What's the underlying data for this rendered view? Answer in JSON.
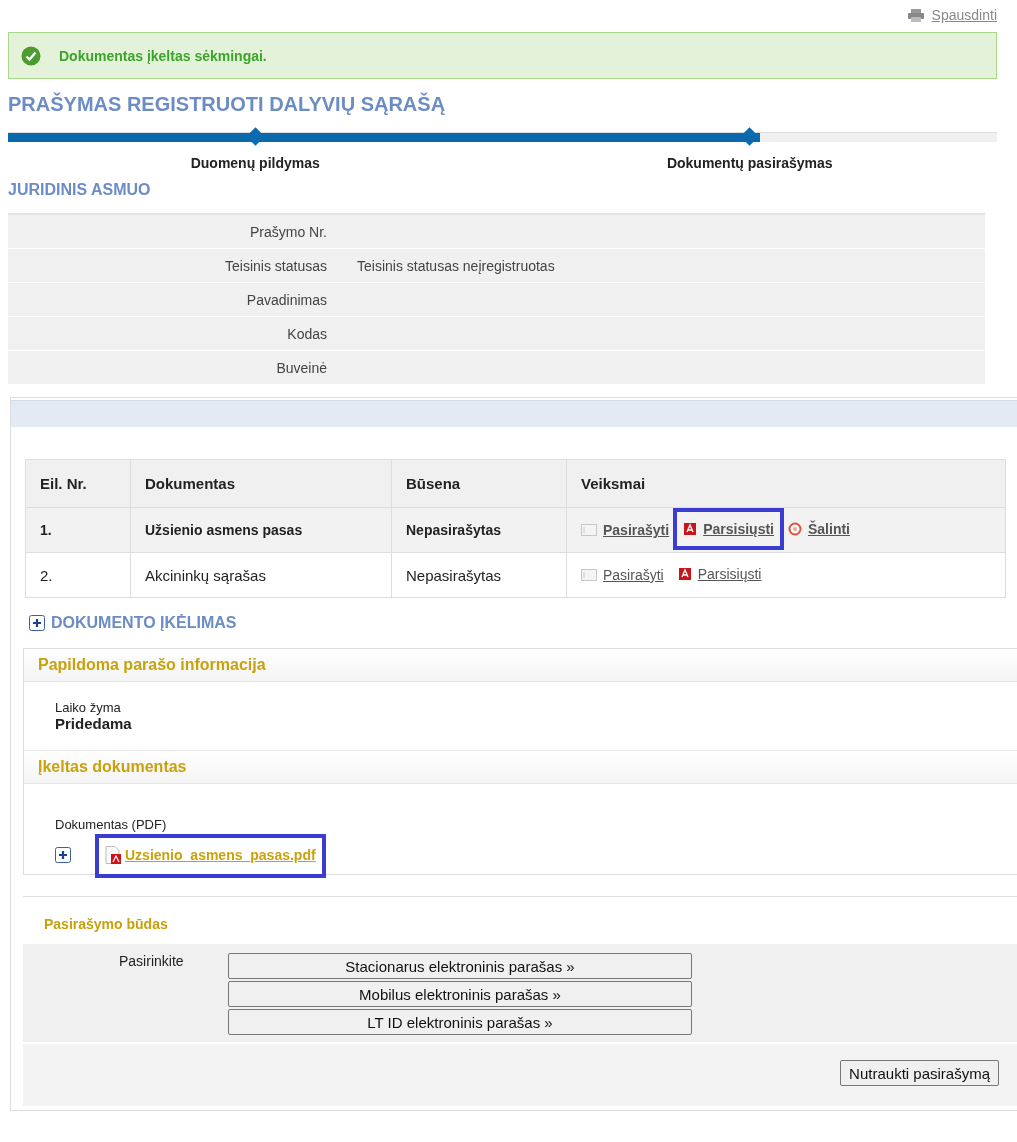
{
  "print_link": {
    "label": "Spausdinti"
  },
  "message": {
    "kind": "success",
    "text": "Dokumentas įkeltas sėkmingai."
  },
  "title": "PRAŠYMAS REGISTRUOTI DALYVIŲ SĄRAŠĄ",
  "progress": {
    "level": 0.76,
    "steps": [
      {
        "label": "Duomenų pildymas",
        "reached": true
      },
      {
        "label": "Dokumentų pasirašymas",
        "reached": true
      }
    ]
  },
  "section_title": "JURIDINIS ASMUO",
  "details": [
    {
      "label": "Prašymo Nr."
    },
    {
      "label": "Teisinis statusas",
      "value": "Teisinis statusas neįregistruotas"
    },
    {
      "label": "Pavadinimas"
    },
    {
      "label": "Kodas"
    },
    {
      "label": "Buveinė"
    }
  ],
  "documents": {
    "columns": [
      "Eil. Nr.",
      "Dokumentas",
      "Būsena",
      "Veiksmai"
    ],
    "rows": [
      {
        "number": "1.",
        "document": "Užsienio asmens pasas",
        "status": "Nepasirašytas",
        "selected": true,
        "actions": [
          {
            "kind": "sign",
            "label": "Pasirašyti",
            "highlighted": false
          },
          {
            "kind": "download",
            "label": "Parsisiųsti",
            "highlighted": true
          },
          {
            "kind": "delete",
            "label": "Šalinti",
            "highlighted": false
          }
        ]
      },
      {
        "number": "2.",
        "document": "Akcininkų sąrašas",
        "status": "Nepasirašytas",
        "selected": false,
        "actions": [
          {
            "kind": "sign",
            "label": "Pasirašyti",
            "highlighted": false
          },
          {
            "kind": "download",
            "label": "Parsisiųsti",
            "highlighted": false
          }
        ]
      }
    ]
  },
  "upload_toggle": {
    "label": "DOKUMENTO ĮKĖLIMAS",
    "expanded": false
  },
  "signature_info": {
    "title": "Papildoma parašo informacija",
    "field_label": "Laiko žyma",
    "field_value": "Pridedama"
  },
  "uploaded": {
    "title": "Įkeltas dokumentas",
    "field_label": "Dokumentas (PDF)",
    "file": {
      "name": "Uzsienio_asmens_pasas.pdf",
      "highlighted": true
    }
  },
  "signing": {
    "title": "Pasirašymo būdas",
    "prompt": "Pasirinkite",
    "methods": [
      "Stacionarus elektroninis parašas »",
      "Mobilus elektroninis parašas »",
      "LT ID elektroninis parašas »"
    ],
    "cancel": "Nutraukti pasirašymą"
  }
}
